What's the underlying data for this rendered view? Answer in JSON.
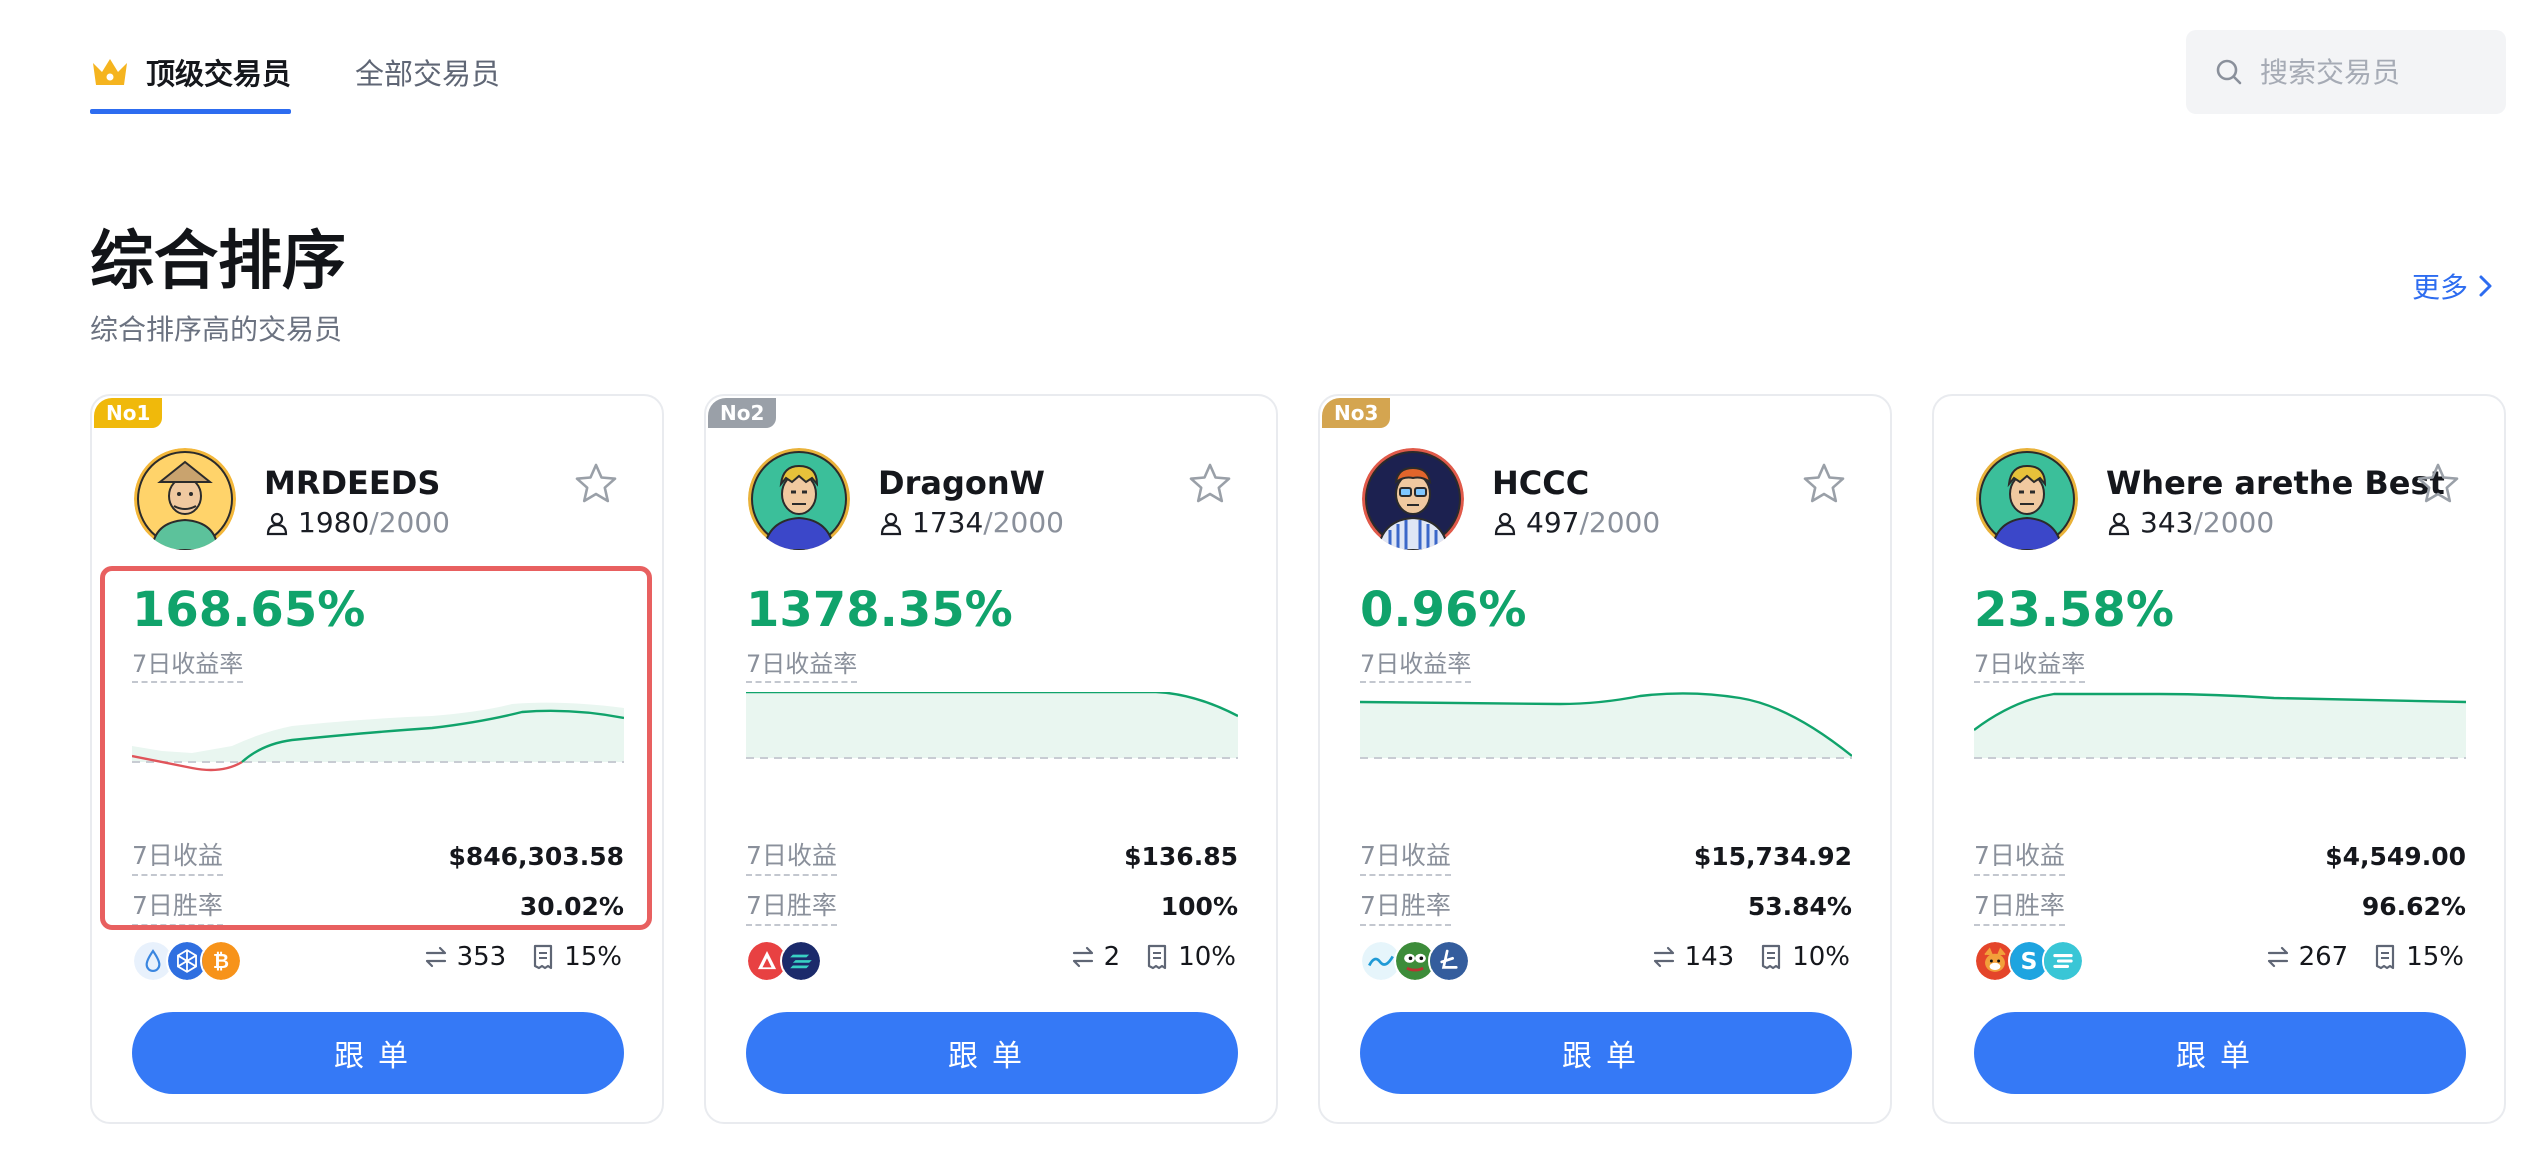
{
  "tabs": [
    {
      "label": "顶级交易员",
      "active": true
    },
    {
      "label": "全部交易员",
      "active": false
    }
  ],
  "search": {
    "placeholder": "搜索交易员"
  },
  "section": {
    "title": "综合排序",
    "subtitle": "综合排序高的交易员",
    "more_label": "更多"
  },
  "labels": {
    "roi_label": "7日收益率",
    "pnl_label": "7日收益",
    "winrate_label": "7日胜率",
    "follow_label": "跟单"
  },
  "colors": {
    "accent": "#3579f6",
    "positive": "#10a36b",
    "negative": "#e0545a",
    "rank1": "#f0b90b",
    "rank2": "#9aa0a8",
    "rank3": "#d4a550",
    "highlight": "#e86060"
  },
  "traders": [
    {
      "rank": "No1",
      "name": "MRDEEDS",
      "followers": "1980",
      "followers_max": "/2000",
      "roi": "168.65%",
      "pnl": "$846,303.58",
      "winrate": "30.02%",
      "trades": "353",
      "share": "15%",
      "coins": [
        "drop-coin-icon",
        "cube-coin-icon",
        "bitcoin-icon"
      ],
      "highlighted": true
    },
    {
      "rank": "No2",
      "name": "DragonW",
      "followers": "1734",
      "followers_max": "/2000",
      "roi": "1378.35%",
      "pnl": "$136.85",
      "winrate": "100%",
      "trades": "2",
      "share": "10%",
      "coins": [
        "avalanche-icon",
        "solana-icon"
      ],
      "highlighted": false
    },
    {
      "rank": "No3",
      "name": "HCCC",
      "followers": "497",
      "followers_max": "/2000",
      "roi": "0.96%",
      "pnl": "$15,734.92",
      "winrate": "53.84%",
      "trades": "143",
      "share": "10%",
      "coins": [
        "wave-coin-icon",
        "pepe-icon",
        "litecoin-icon"
      ],
      "highlighted": false
    },
    {
      "rank": "",
      "name": "Where arethe Best",
      "followers": "343",
      "followers_max": "/2000",
      "roi": "23.58%",
      "pnl": "$4,549.00",
      "winrate": "96.62%",
      "trades": "267",
      "share": "15%",
      "coins": [
        "shiba-icon",
        "sushi-s-icon",
        "lines-coin-icon"
      ],
      "highlighted": false
    }
  ]
}
